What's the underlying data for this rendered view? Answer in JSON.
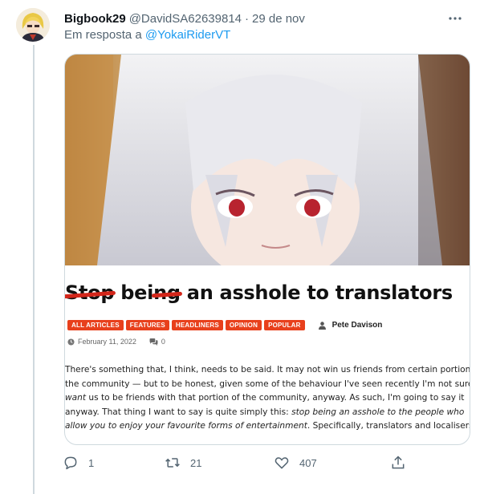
{
  "tweet": {
    "author_name": "Bigbook29",
    "author_handle": "@DavidSA62639814",
    "separator": "·",
    "date": "29 de nov",
    "reply_prefix": "Em resposta a",
    "reply_to": "@YokaiRiderVT"
  },
  "card": {
    "headline": {
      "struck_1": "Stop",
      "plain_1": " bei",
      "struck_2": "ng",
      "plain_2": " an asshole to translators"
    },
    "tags": [
      "ALL ARTICLES",
      "FEATURES",
      "HEADLINERS",
      "OPINION",
      "POPULAR"
    ],
    "author": "Pete Davison",
    "date": "February 11, 2022",
    "comments": "0",
    "article": {
      "l1": "There's something that, I think, needs to be said. It may not win us friends from certain portions of",
      "l2": "the community — but to be honest, given some of the behaviour I've seen recently I'm not sure I'd",
      "l3_em": "want",
      "l3_rest": " us to be friends with that portion of the community, anyway. As such, I'm going to say it",
      "l4_a": "anyway. That thing I want to say is quite simply this: ",
      "l4_em": "stop being an asshole to the people who",
      "l5_em": "allow you to enjoy your favourite forms of entertainment",
      "l5_rest": ". Specifically, translators and localisers."
    }
  },
  "actions": {
    "reply_count": "1",
    "retweet_count": "21",
    "like_count": "407"
  },
  "colors": {
    "accent": "#1d9bf0",
    "tag": "#e8401c",
    "strike": "#d3261a",
    "muted": "#536471"
  }
}
